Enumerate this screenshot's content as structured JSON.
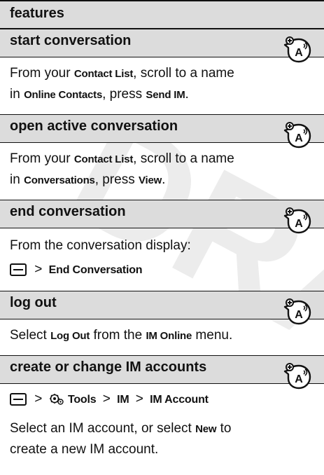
{
  "header": {
    "title": "features"
  },
  "features": [
    {
      "title": "start conversation",
      "icon": "network-dependent-icon",
      "lines": [
        [
          {
            "t": "From your "
          },
          {
            "k": "Contact List"
          },
          {
            "t": ", scroll to a name"
          }
        ],
        [
          {
            "t": "in "
          },
          {
            "k": "Online Contacts"
          },
          {
            "t": ", press "
          },
          {
            "k": "Send IM"
          },
          {
            "t": "."
          }
        ]
      ]
    },
    {
      "title": "open active conversation",
      "icon": "network-dependent-icon",
      "lines": [
        [
          {
            "t": "From your "
          },
          {
            "k": "Contact List"
          },
          {
            "t": ", scroll to a name"
          }
        ],
        [
          {
            "t": "in "
          },
          {
            "k": "Conversations"
          },
          {
            "t": ", press "
          },
          {
            "k": "View"
          },
          {
            "t": "."
          }
        ]
      ]
    },
    {
      "title": "end conversation",
      "icon": "network-dependent-icon",
      "text1": "From the conversation display:",
      "path_sep": ">",
      "path_items": [
        "End Conversation"
      ]
    },
    {
      "title": "log out",
      "icon": "network-dependent-icon",
      "lines": [
        [
          {
            "t": "Select "
          },
          {
            "k": "Log Out"
          },
          {
            "t": " from the "
          },
          {
            "k": "IM Online"
          },
          {
            "t": " menu."
          }
        ]
      ]
    },
    {
      "title": "create or change IM accounts",
      "icon": "network-dependent-icon",
      "path_sep": ">",
      "path_items": [
        "Tools",
        "IM",
        "IM Account"
      ],
      "lines": [
        [
          {
            "t": "Select an IM account, or select "
          },
          {
            "k": "New"
          },
          {
            "t": " to"
          }
        ],
        [
          {
            "t": "create a new IM account."
          }
        ]
      ]
    }
  ],
  "watermark": {
    "text": "DRAFT",
    "color": "#ececec"
  }
}
